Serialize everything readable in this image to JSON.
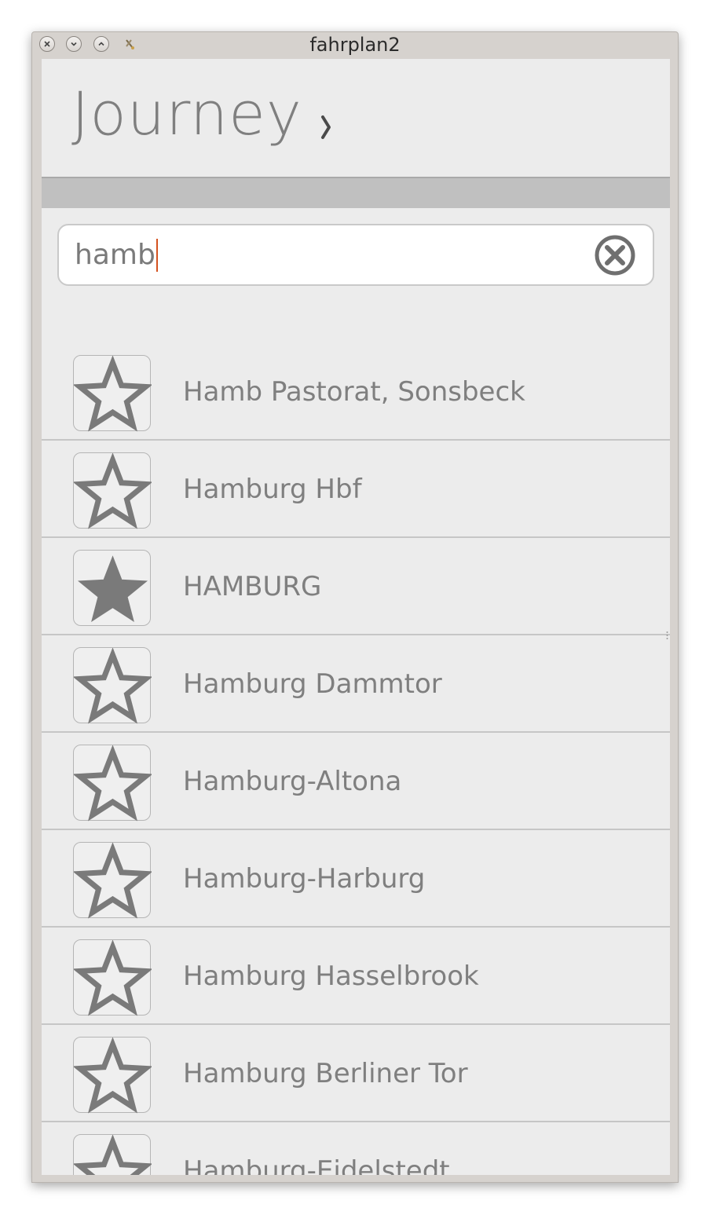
{
  "window": {
    "title": "fahrplan2"
  },
  "header": {
    "title": "Journey"
  },
  "search": {
    "value": "hamb"
  },
  "stations": [
    {
      "name": "Hamb Pastorat, Sonsbeck",
      "favorite": false
    },
    {
      "name": "Hamburg Hbf",
      "favorite": false
    },
    {
      "name": "HAMBURG",
      "favorite": true
    },
    {
      "name": "Hamburg Dammtor",
      "favorite": false
    },
    {
      "name": "Hamburg-Altona",
      "favorite": false
    },
    {
      "name": "Hamburg-Harburg",
      "favorite": false
    },
    {
      "name": "Hamburg Hasselbrook",
      "favorite": false
    },
    {
      "name": "Hamburg Berliner Tor",
      "favorite": false
    },
    {
      "name": "Hamburg-Eidelstedt",
      "favorite": false
    }
  ],
  "icons": {
    "close": "close-icon",
    "minimize": "minimize-icon",
    "maximize": "maximize-icon",
    "pin": "pin-icon",
    "chevron": "chevron-right-icon",
    "clear": "clear-search-icon",
    "star_empty": "star-outline-icon",
    "star_filled": "star-filled-icon"
  },
  "colors": {
    "accent_caret": "#d4521f",
    "star": "#7a7a7a",
    "text": "#7f7f7f"
  }
}
